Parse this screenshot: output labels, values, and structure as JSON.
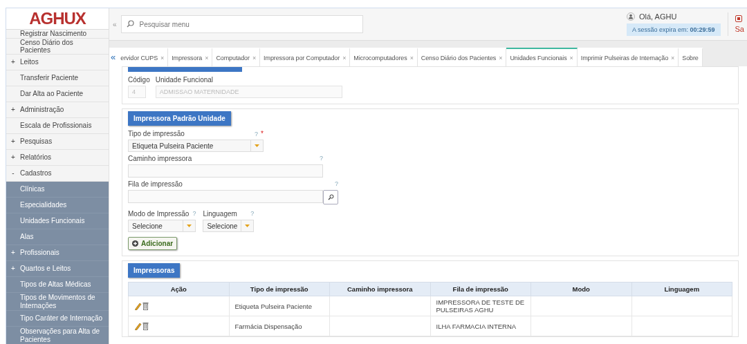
{
  "logo": {
    "text": "AGHUX"
  },
  "collapse_button": "«",
  "search": {
    "placeholder": "Pesquisar menu"
  },
  "user": {
    "greeting": "Olá, AGHU",
    "session_label": "A sessão expira em:",
    "session_time": "00:29:59",
    "logout": "Sa"
  },
  "sidebar": {
    "items": [
      {
        "label": "Registrar Nascimento"
      },
      {
        "label": "Censo Diário dos Pacientes"
      },
      {
        "label": "Leitos",
        "marker": "+"
      },
      {
        "label": "Transferir Paciente"
      },
      {
        "label": "Dar Alta ao Paciente"
      },
      {
        "label": "Administração",
        "marker": "+"
      },
      {
        "label": "Escala de Profissionais"
      },
      {
        "label": "Pesquisas",
        "marker": "+"
      },
      {
        "label": "Relatórios",
        "marker": "+"
      },
      {
        "label": "Cadastros",
        "marker": "-",
        "children": [
          {
            "label": "Clínicas"
          },
          {
            "label": "Especialidades"
          },
          {
            "label": "Unidades Funcionais"
          },
          {
            "label": "Alas"
          },
          {
            "label": "Profissionais",
            "marker": "+"
          },
          {
            "label": "Quartos e Leitos",
            "marker": "+"
          },
          {
            "label": "Tipos de Altas Médicas"
          },
          {
            "label": "Tipos de Movimentos de Internações"
          },
          {
            "label": "Tipo Caráter de Internação"
          },
          {
            "label": "Observações para Alta de Pacientes"
          }
        ]
      }
    ]
  },
  "tab_scroll": "«",
  "tabs": [
    {
      "label": "ervidor CUPS",
      "close": "×",
      "selected": false
    },
    {
      "label": "Impressora",
      "close": "×",
      "selected": false
    },
    {
      "label": "Computador",
      "close": "×",
      "selected": false
    },
    {
      "label": "Impressora por Computador",
      "close": "×",
      "selected": false
    },
    {
      "label": "Microcomputadores",
      "close": "×",
      "selected": false
    },
    {
      "label": "Censo Diário dos Pacientes",
      "close": "×",
      "selected": false
    },
    {
      "label": "Unidades Funcionais",
      "close": "×",
      "selected": true
    },
    {
      "label": "Imprimir Pulseiras de Internação",
      "close": "×",
      "selected": false
    },
    {
      "label": "Sobre",
      "selected": false
    }
  ],
  "unit": {
    "code_label": "Código",
    "code": "4",
    "unit_label": "Unidade Funcional",
    "unit": "ADMISSAO MATERNIDADE"
  },
  "form": {
    "title": "Impressora Padrão Unidade",
    "print_type": {
      "label": "Tipo de impressão",
      "value": "Etiqueta Pulseira Paciente",
      "help": "?",
      "required": "*"
    },
    "path": {
      "label": "Caminho impressora",
      "help": "?"
    },
    "queue": {
      "label": "Fila de impressão",
      "help": "?"
    },
    "mode": {
      "label": "Modo de Impressão",
      "help": "?",
      "value": "Selecione"
    },
    "language": {
      "label": "Linguagem",
      "help": "?",
      "value": "Selecione"
    },
    "add_button": "Adicionar"
  },
  "printers": {
    "title": "Impressoras",
    "columns": [
      "Ação",
      "Tipo de impressão",
      "Caminho impressora",
      "Fila de impressão",
      "Modo",
      "Linguagem"
    ],
    "rows": [
      {
        "print_type": "Etiqueta Pulseira Paciente",
        "queue": "IMPRESSORA DE TESTE DE PULSEIRAS AGHU"
      },
      {
        "print_type": "Farmácia Dispensação",
        "queue": "ILHA FARMACIA INTERNA"
      }
    ]
  }
}
